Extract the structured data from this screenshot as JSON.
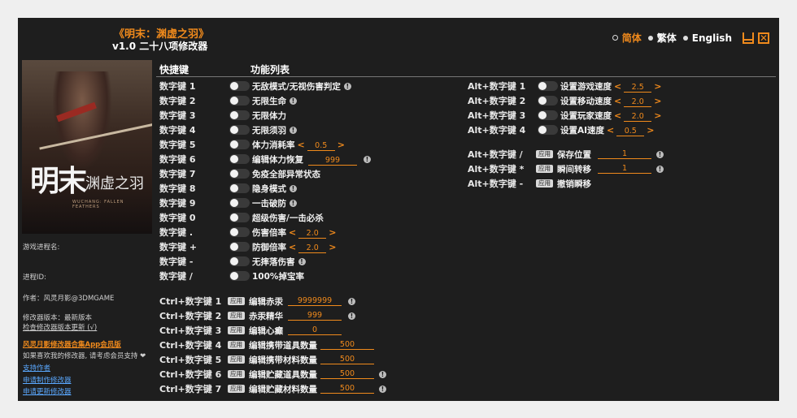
{
  "header": {
    "title": "《明末：渊虚之羽》",
    "subtitle": "v1.0 二十八项修改器"
  },
  "languages": [
    {
      "label": "简体",
      "selected": true
    },
    {
      "label": "繁体",
      "selected": false
    },
    {
      "label": "English",
      "selected": false
    }
  ],
  "columns": {
    "hotkey": "快捷键",
    "functions": "功能列表"
  },
  "cover": {
    "logo_main": "明末",
    "logo_side": "渊虚之羽",
    "logo_sub": "WUCHANG: FALLEN FEATHERS"
  },
  "sidebar": {
    "process_name_label": "游戏进程名:",
    "process_id_label": "进程ID:",
    "author": "作者：风灵月影@3DMGAME",
    "version_line": "修改器版本：最新版本",
    "check_update": "检查修改器版本更新 (√)",
    "app_promo": "风灵月影修改器合集App会员版",
    "support_text": "如果喜欢我的修改器, 请考虑会员支持 ❤",
    "support_link": "支持作者",
    "request_make": "申请制作修改器",
    "request_update": "申请更新修改器"
  },
  "left_rows": [
    {
      "key": "数字键 1",
      "label": "无敌模式/无视伤害判定",
      "info": true
    },
    {
      "key": "数字键 2",
      "label": "无限生命",
      "info": true
    },
    {
      "key": "数字键 3",
      "label": "无限体力",
      "info": false
    },
    {
      "key": "数字键 4",
      "label": "无限须羽",
      "info": true
    },
    {
      "key": "数字键 5",
      "label": "体力消耗率",
      "value": "0.5",
      "arrows": true
    },
    {
      "key": "数字键 6",
      "label": "编辑体力恢复",
      "value": "999",
      "info": true
    },
    {
      "key": "数字键 7",
      "label": "免疫全部异常状态"
    },
    {
      "key": "数字键 8",
      "label": "隐身模式",
      "info": true
    },
    {
      "key": "数字键 9",
      "label": "一击破防",
      "info": true
    },
    {
      "key": "数字键 0",
      "label": "超级伤害/一击必杀"
    },
    {
      "key": "数字键 .",
      "label": "伤害倍率",
      "value": "2.0",
      "arrows": true
    },
    {
      "key": "数字键 +",
      "label": "防御倍率",
      "value": "2.0",
      "arrows": true
    },
    {
      "key": "数字键 -",
      "label": "无摔落伤害",
      "info": true
    },
    {
      "key": "数字键 /",
      "label": "100%掉宝率"
    }
  ],
  "ctrl_rows": [
    {
      "key": "Ctrl+数字键 1",
      "apply": "应用",
      "label": "编辑赤汞",
      "value": "9999999",
      "info": true
    },
    {
      "key": "Ctrl+数字键 2",
      "apply": "应用",
      "label": "赤汞精华",
      "value": "999",
      "info": true
    },
    {
      "key": "Ctrl+数字键 3",
      "apply": "应用",
      "label": "编辑心癫",
      "value": "0"
    },
    {
      "key": "Ctrl+数字键 4",
      "apply": "应用",
      "label": "编辑携带道具数量",
      "value": "500"
    },
    {
      "key": "Ctrl+数字键 5",
      "apply": "应用",
      "label": "编辑携带材料数量",
      "value": "500"
    },
    {
      "key": "Ctrl+数字键 6",
      "apply": "应用",
      "label": "编辑贮藏道具数量",
      "value": "500",
      "info": true
    },
    {
      "key": "Ctrl+数字键 7",
      "apply": "应用",
      "label": "编辑贮藏材料数量",
      "value": "500",
      "info": true
    }
  ],
  "alt_rows": [
    {
      "key": "Alt+数字键 1",
      "label": "设置游戏速度",
      "value": "2.5"
    },
    {
      "key": "Alt+数字键 2",
      "label": "设置移动速度",
      "value": "2.0"
    },
    {
      "key": "Alt+数字键 3",
      "label": "设置玩家速度",
      "value": "2.0"
    },
    {
      "key": "Alt+数字键 4",
      "label": "设置AI速度",
      "value": "0.5"
    }
  ],
  "alt_apply_rows": [
    {
      "key": "Alt+数字键 /",
      "apply": "应用",
      "label": "保存位置",
      "value": "1",
      "info": true
    },
    {
      "key": "Alt+数字键 *",
      "apply": "应用",
      "label": "瞬间转移",
      "value": "1",
      "info": true
    },
    {
      "key": "Alt+数字键 -",
      "apply": "应用",
      "label": "撤销瞬移"
    }
  ],
  "colors": {
    "accent": "#f08a1c",
    "background": "#1e1e1e",
    "link": "#5aa8ff"
  }
}
